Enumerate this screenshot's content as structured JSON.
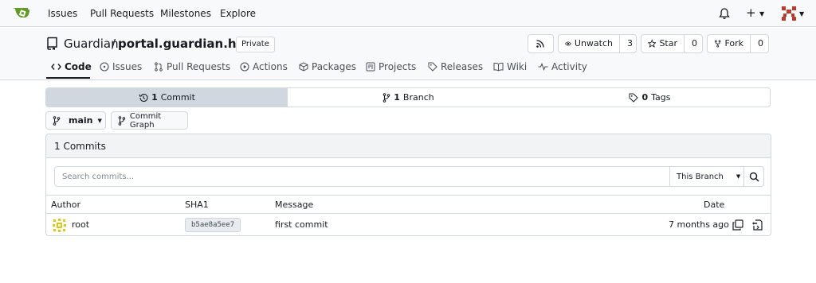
{
  "topnav": {
    "links": [
      "Issues",
      "Pull Requests",
      "Milestones",
      "Explore"
    ],
    "icons": {
      "logo": "gitea-logo-icon",
      "bell": "bell-icon",
      "create": "plus-icon",
      "avatar": "user-avatar"
    },
    "create_label": "+"
  },
  "repo": {
    "owner": "Guardian",
    "separator": "/",
    "name": "portal.guardian.htb",
    "visibility": "Private",
    "actions": {
      "rss_icon": "rss-icon",
      "watch_label": "Unwatch",
      "watch_count": "3",
      "star_label": "Star",
      "star_count": "0",
      "fork_label": "Fork",
      "fork_count": "0"
    },
    "tabs": [
      {
        "label": "Code",
        "icon": "code-icon",
        "active": true
      },
      {
        "label": "Issues",
        "icon": "issue-icon"
      },
      {
        "label": "Pull Requests",
        "icon": "pull-request-icon"
      },
      {
        "label": "Actions",
        "icon": "play-icon"
      },
      {
        "label": "Packages",
        "icon": "package-icon"
      },
      {
        "label": "Projects",
        "icon": "project-icon"
      },
      {
        "label": "Releases",
        "icon": "tag-icon"
      },
      {
        "label": "Wiki",
        "icon": "book-icon"
      },
      {
        "label": "Activity",
        "icon": "pulse-icon"
      }
    ]
  },
  "stats": {
    "commits_count": "1",
    "commits_label": "Commit",
    "branches_count": "1",
    "branches_label": "Branch",
    "tags_count": "0",
    "tags_label": "Tags"
  },
  "branch": {
    "current": "main",
    "graph_label": "Commit Graph"
  },
  "commits": {
    "title": "1 Commits",
    "search_placeholder": "Search commits...",
    "scope": "This Branch",
    "columns": {
      "author": "Author",
      "sha": "SHA1",
      "message": "Message",
      "date": "Date"
    },
    "rows": [
      {
        "author": "root",
        "sha": "b5ae8a5ee7",
        "message": "first commit",
        "date": "7 months ago"
      }
    ]
  },
  "colors": {
    "accent": "#609926",
    "border": "#d0d7de",
    "header_bg": "#f8f9fb",
    "avatar": "#c03a2b"
  }
}
